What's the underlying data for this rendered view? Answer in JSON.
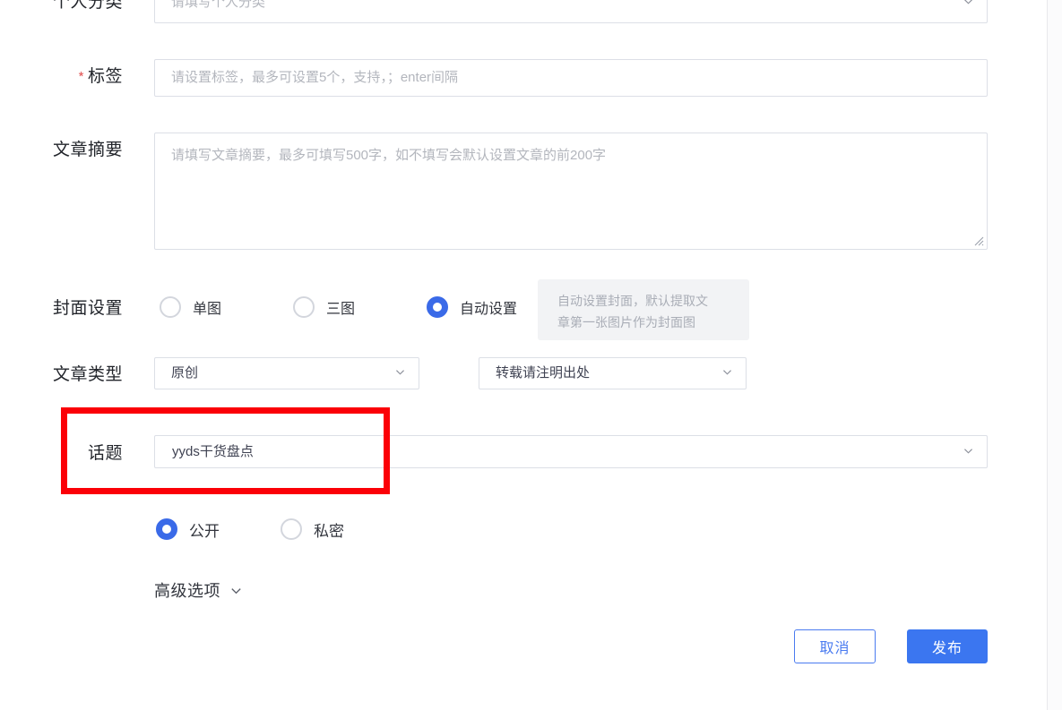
{
  "form": {
    "category": {
      "label": "个人分类",
      "placeholder": "请填写个人分类"
    },
    "tags": {
      "label": "标签",
      "required_mark": "*",
      "placeholder": "请设置标签，最多可设置5个，支持，；enter间隔"
    },
    "summary": {
      "label": "文章摘要",
      "placeholder": "请填写文章摘要，最多可填写500字，如不填写会默认设置文章的前200字"
    },
    "cover": {
      "label": "封面设置",
      "options": [
        {
          "label": "单图",
          "selected": false
        },
        {
          "label": "三图",
          "selected": false
        },
        {
          "label": "自动设置",
          "selected": true
        }
      ],
      "tooltip": {
        "line1": "自动设置封面，默认提取文",
        "line2": "章第一张图片作为封面图"
      }
    },
    "article_type": {
      "label": "文章类型",
      "origin_value": "原创",
      "repost_value": "转载请注明出处"
    },
    "topic": {
      "label": "话题",
      "value": "yyds干货盘点"
    },
    "privacy": {
      "options": [
        {
          "label": "公开",
          "selected": true
        },
        {
          "label": "私密",
          "selected": false
        }
      ]
    },
    "advanced": {
      "label": "高级选项"
    },
    "footer": {
      "cancel_label": "取消",
      "publish_label": "发布"
    }
  },
  "colors": {
    "accent_blue": "#3b76f0",
    "radio_blue": "#3a6ae8",
    "annotation_red": "#fb0007",
    "required_red": "#e04a4a",
    "border_gray": "#dcdfe6",
    "placeholder_gray": "#b3b6bd",
    "tooltip_bg": "#f2f3f5"
  }
}
